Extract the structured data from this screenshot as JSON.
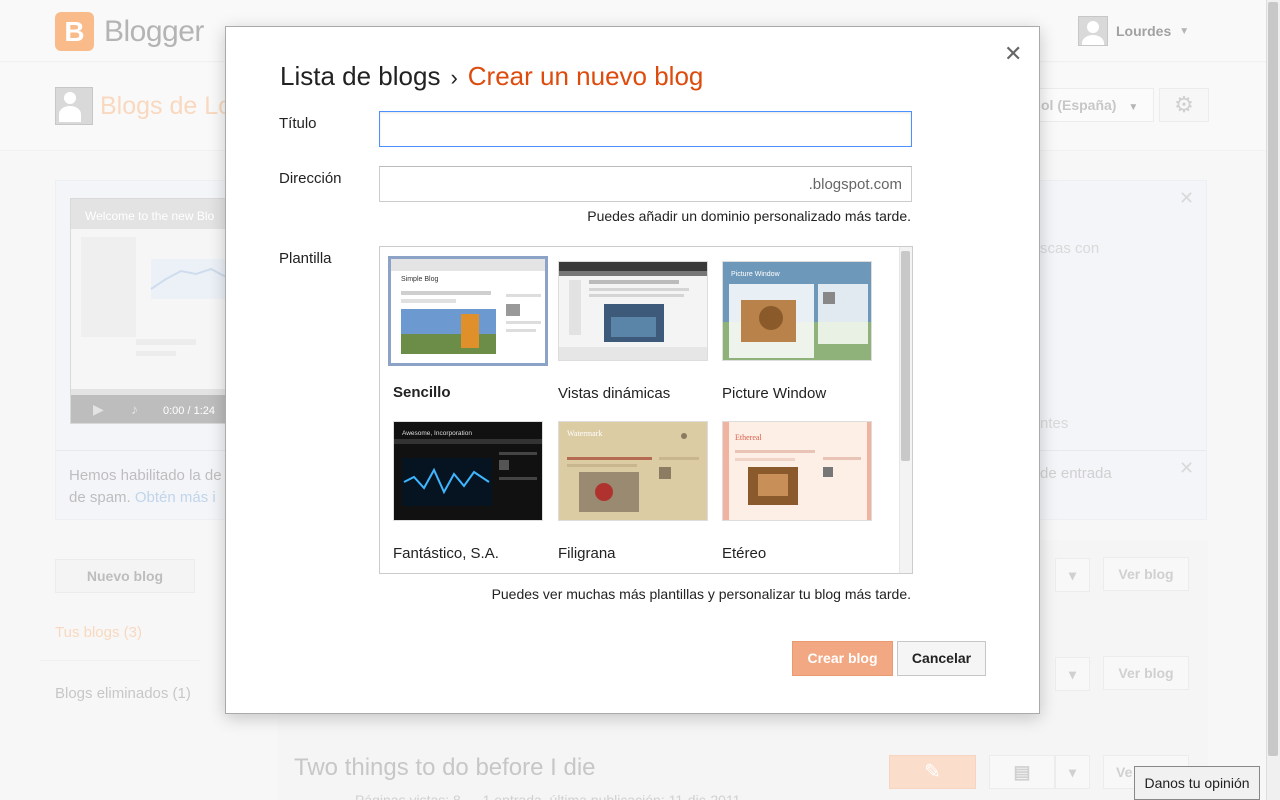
{
  "app": {
    "name": "Blogger",
    "user": "Lourdes"
  },
  "dashboard": {
    "title": "Blogs de Lo",
    "language": "ol (España)",
    "video_title": "Welcome to the new Blo",
    "video_time": "0:00 / 1:24",
    "panel_text_1": "scas con",
    "panel_text_2": "ntes",
    "notice_line1": "Hemos habilitado la de",
    "notice_line2": "de spam.",
    "notice_link": "Obtén más i",
    "notice_right": "de entrada",
    "new_blog_button": "Nuevo blog",
    "your_blogs": "Tus blogs (3)",
    "deleted_blogs": "Blogs eliminados (1)",
    "view_blog": "Ver blog",
    "view_blog_cut": "Ve",
    "blog_title": "Two things to do before I die",
    "blog_meta": "Páginas vistas: 8 — 1 entrada, última publicación: 11-dic-2011"
  },
  "dialog": {
    "breadcrumb_parent": "Lista de blogs",
    "breadcrumb_separator": "›",
    "breadcrumb_current": "Crear un nuevo blog",
    "title_label": "Título",
    "title_value": "",
    "address_label": "Dirección",
    "address_value": "",
    "address_suffix": ".blogspot.com",
    "address_hint": "Puedes añadir un dominio personalizado más tarde.",
    "template_label": "Plantilla",
    "templates": [
      {
        "name": "Sencillo",
        "selected": true
      },
      {
        "name": "Vistas dinámicas",
        "selected": false
      },
      {
        "name": "Picture Window",
        "selected": false
      },
      {
        "name": "Fantástico, S.A.",
        "selected": false
      },
      {
        "name": "Filigrana",
        "selected": false
      },
      {
        "name": "Etéreo",
        "selected": false
      }
    ],
    "template_hint": "Puedes ver muchas más plantillas y personalizar tu blog más tarde.",
    "create_button": "Crear blog",
    "cancel_button": "Cancelar",
    "close_icon": "close-icon"
  },
  "feedback_button": "Danos tu opinión",
  "colors": {
    "accent": "#dd4b0d",
    "create_button": "#f2a882",
    "focus_border": "#4d90fe",
    "selected_template_border": "#8ca3c7"
  }
}
